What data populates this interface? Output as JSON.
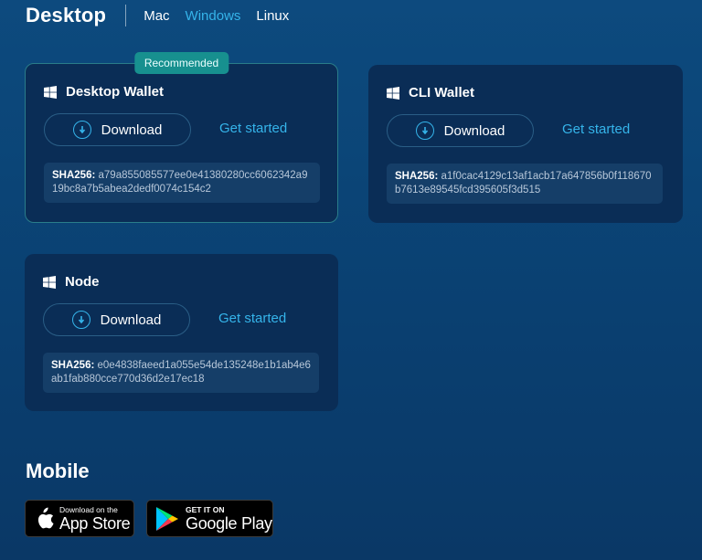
{
  "header": {
    "title": "Desktop",
    "os_tabs": [
      {
        "label": "Mac",
        "active": false
      },
      {
        "label": "Windows",
        "active": true
      },
      {
        "label": "Linux",
        "active": false
      }
    ]
  },
  "cards": [
    {
      "title": "Desktop Wallet",
      "icon": "windows-icon",
      "badge": "Recommended",
      "download_label": "Download",
      "get_started_label": "Get started",
      "sha_label": "SHA256:",
      "sha_value": "a79a855085577ee0e41380280cc6062342a919bc8a7b5abea2dedf0074c154c2"
    },
    {
      "title": "CLI Wallet",
      "icon": "windows-icon",
      "download_label": "Download",
      "get_started_label": "Get started",
      "sha_label": "SHA256:",
      "sha_value": "a1f0cac4129c13af1acb17a647856b0f118670b7613e89545fcd395605f3d515"
    },
    {
      "title": "Node",
      "icon": "windows-icon",
      "download_label": "Download",
      "get_started_label": "Get started",
      "sha_label": "SHA256:",
      "sha_value": "e0e4838faeed1a055e54de135248e1b1ab4e6ab1fab880cce770d36d2e17ec18"
    }
  ],
  "mobile": {
    "title": "Mobile",
    "app_store": {
      "small": "Download on the",
      "big": "App Store",
      "icon": "apple-icon"
    },
    "google_play": {
      "small": "GET IT ON",
      "big": "Google Play",
      "icon": "google-play-icon"
    }
  },
  "colors": {
    "accent": "#35b4ea",
    "badge": "#17908f",
    "card_bg": "#0a2d56",
    "sha_bg": "#153e68"
  }
}
